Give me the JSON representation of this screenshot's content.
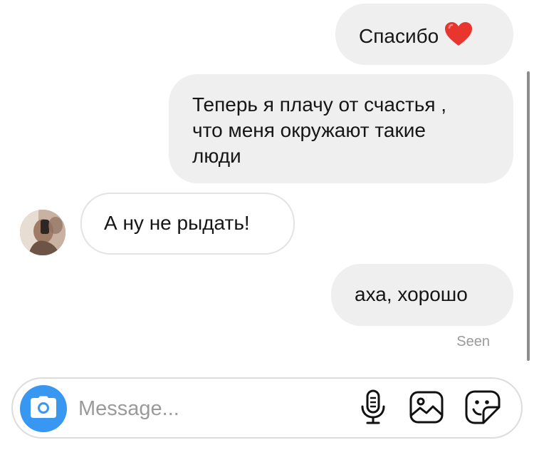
{
  "messages": [
    {
      "direction": "outgoing",
      "text": "Спасибо",
      "emoji": "heart"
    },
    {
      "direction": "outgoing",
      "lines": [
        "Теперь я плачу от счастья ,",
        "что меня окружают такие",
        "люди"
      ]
    },
    {
      "direction": "incoming",
      "text": "А ну не рыдать!"
    },
    {
      "direction": "outgoing",
      "text": "аха, хорошо"
    }
  ],
  "status": {
    "seen_label": "Seen"
  },
  "composer": {
    "placeholder": "Message...",
    "value": ""
  },
  "icons": {
    "camera": "camera-icon",
    "mic": "microphone-icon",
    "gallery": "gallery-icon",
    "sticker": "sticker-icon",
    "heart": "heart-emoji"
  },
  "colors": {
    "accent": "#3897f0",
    "outgoing_bubble": "#efefef",
    "incoming_border": "#e3e3e3",
    "heart": "#e8362f",
    "muted_text": "#9a9a9a"
  }
}
